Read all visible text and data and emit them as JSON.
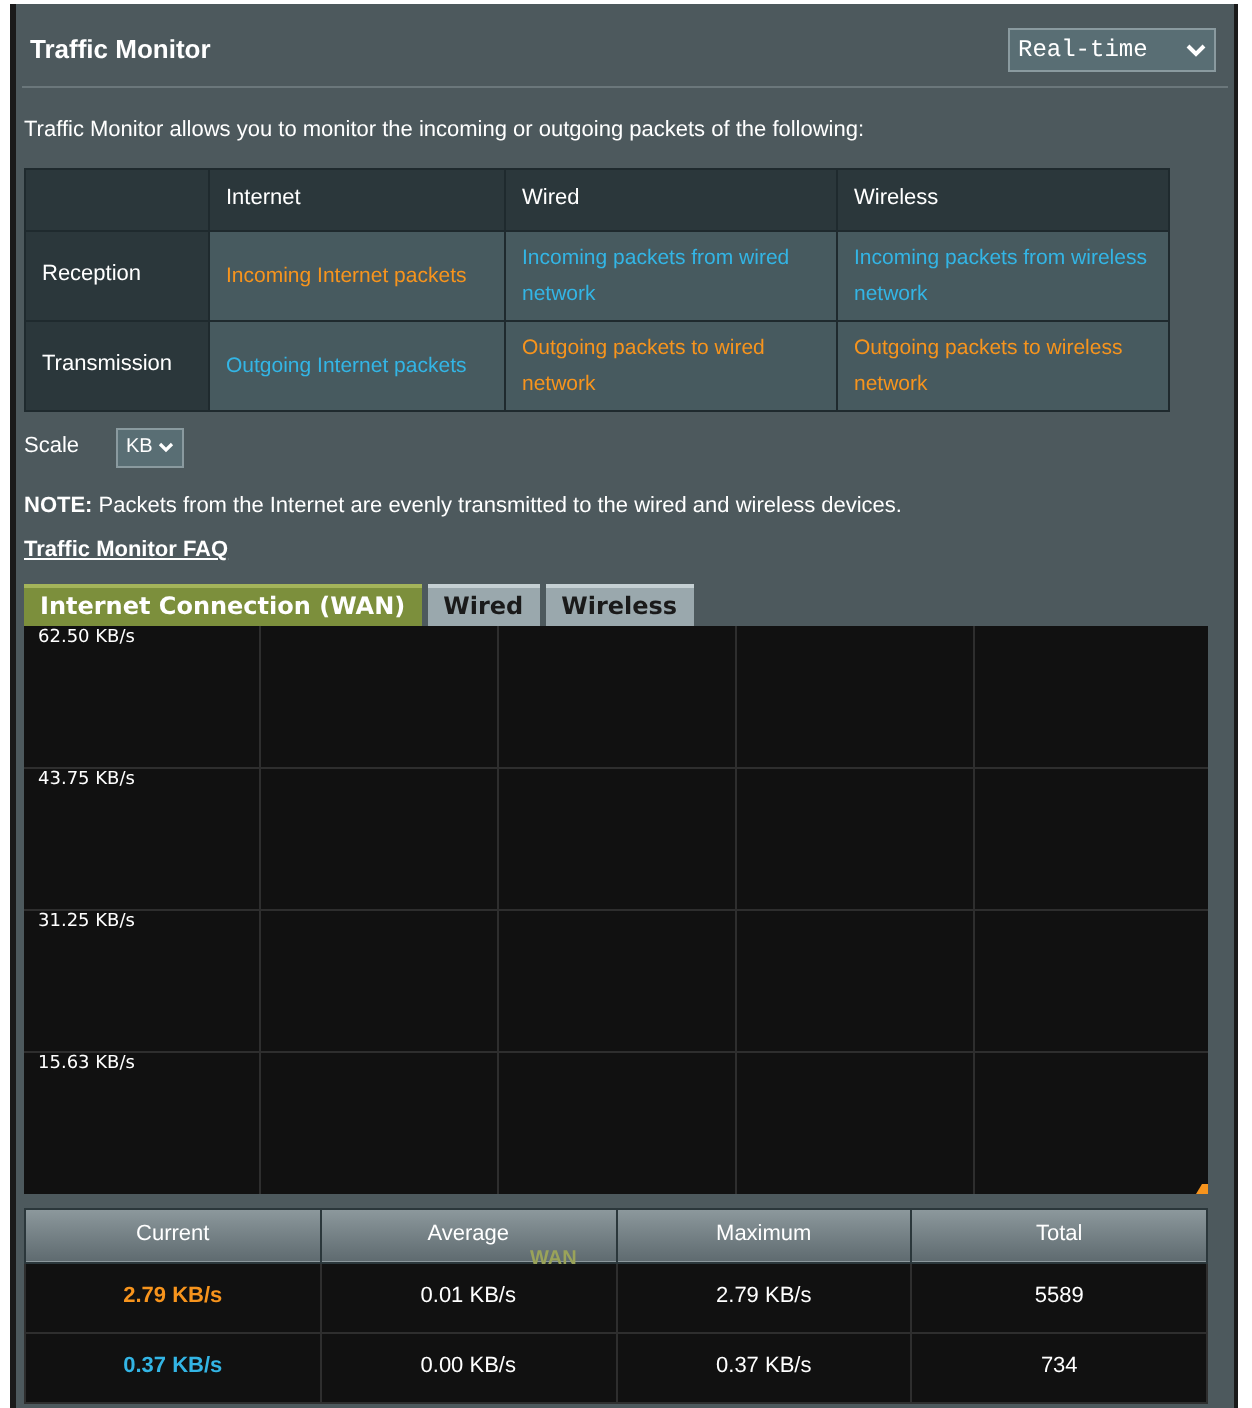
{
  "title": "Traffic Monitor",
  "mode_select": {
    "value": "Real-time"
  },
  "intro": "Traffic Monitor allows you to monitor the incoming or outgoing packets of the following:",
  "packet_table": {
    "columns": [
      "Internet",
      "Wired",
      "Wireless"
    ],
    "rows": [
      {
        "label": "Reception",
        "cells": [
          {
            "text": "Incoming Internet packets",
            "color": "#f7941d"
          },
          {
            "text": "Incoming packets from wired network",
            "color": "#33b5e5"
          },
          {
            "text": "Incoming packets from wireless network",
            "color": "#33b5e5"
          }
        ]
      },
      {
        "label": "Transmission",
        "cells": [
          {
            "text": "Outgoing Internet packets",
            "color": "#33b5e5"
          },
          {
            "text": "Outgoing packets to wired network",
            "color": "#f7941d"
          },
          {
            "text": "Outgoing packets to wireless network",
            "color": "#f7941d"
          }
        ]
      }
    ]
  },
  "scale": {
    "label": "Scale",
    "value": "KB"
  },
  "note": "**NOTE:** Packets from the Internet are evenly transmitted to the wired and wireless devices.",
  "faq_link": "Traffic Monitor FAQ",
  "tabs": [
    {
      "label": "Internet Connection (WAN)",
      "selected": true
    },
    {
      "label": "Wired",
      "selected": false
    },
    {
      "label": "Wireless",
      "selected": false
    }
  ],
  "graph": {
    "y_labels": [
      "62.50 KB/s",
      "43.75 KB/s",
      "31.25 KB/s",
      "15.63 KB/s"
    ]
  },
  "legend": "WAN",
  "stats": {
    "columns": [
      "Current",
      "Average",
      "Maximum",
      "Total"
    ],
    "rows": [
      {
        "color": "#f7941d",
        "cells": [
          "2.79 KB/s",
          "0.01 KB/s",
          "2.79 KB/s",
          "5589"
        ]
      },
      {
        "color": "#33b5e5",
        "cells": [
          "0.37 KB/s",
          "0.00 KB/s",
          "0.37 KB/s",
          "734"
        ]
      }
    ]
  }
}
